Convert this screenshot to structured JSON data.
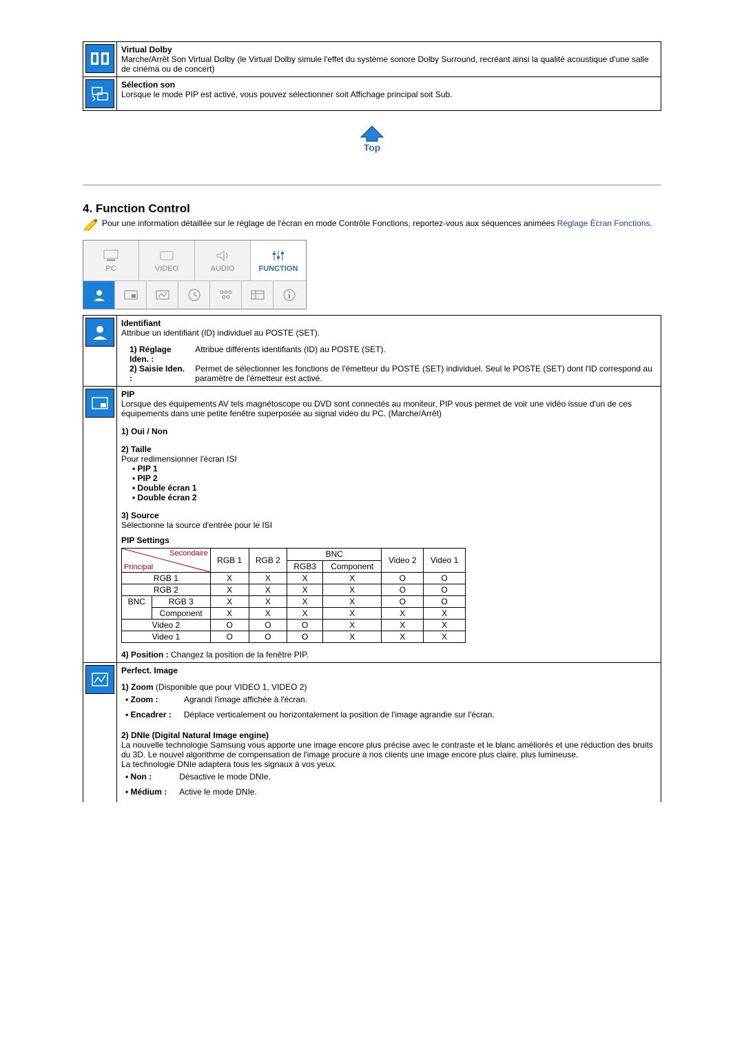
{
  "audio_section": {
    "virtual_dolby": {
      "title": "Virtual Dolby",
      "desc": "Marche/Arrêt Son Virtual Dolby (le Virtual Dolby simule l'effet du système sonore Dolby Surround, recréant ainsi la qualité acoustique d'une salle de cinéma ou de concert)"
    },
    "sound_select": {
      "title": "Sélection son",
      "desc": "Lorsque le mode PIP est activé, vous pouvez sélectionner soit Affichage principal soit Sub."
    }
  },
  "top_label": "Top",
  "section4": {
    "heading": "4. Function Control",
    "intro": "Pour une information détaillée sur le réglage de l'écran en mode Contrôle Fonctions, reportez-vous aux séquences animées ",
    "intro_link": "Réglage Écran Fonctions",
    "intro_end": ".",
    "tabs": {
      "pc": "PC",
      "video": "VIDEO",
      "audio": "AUDIO",
      "function": "FUNCTION"
    }
  },
  "identifiant": {
    "title": "Identifiant",
    "desc": "Attribue un identifiant (ID) individuel au POSTE (SET).",
    "row1_label": "1) Réglage Iden. :",
    "row1_desc": "Attribue différents identifiants (ID) au POSTE (SET).",
    "row2_label": "2) Saisie Iden. :",
    "row2_desc": "Permet de sélectionner les fonctions de l'émetteur du POSTE (SET) individuel. Seul le POSTE (SET) dont l'ID correspond au paramètre de l'émetteur est activé."
  },
  "pip": {
    "title": "PIP",
    "desc": "Lorsque des équipements AV tels magnétoscope ou DVD sont connectés au moniteur, PIP vous permet de voir une vidéo issue d'un de ces équipements dans une petite fenêtre superposée au signal vidéo du PC. (Marche/Arrêt)",
    "opt1": "1) Oui / Non",
    "opt2": "2) Taille",
    "opt2_desc": "Pour redimensionner l'écran ISI",
    "bullets": [
      "• PIP 1",
      "• PIP 2",
      "• Double écran 1",
      "• Double écran 2"
    ],
    "opt3": "3) Source",
    "opt3_desc": "Sélectionne la source d'entrée pour le ISI",
    "settings_title": "PIP Settings",
    "diag_secondary": "Secondaire",
    "diag_primary": "Principal",
    "headers": {
      "rgb1": "RGB 1",
      "rgb2": "RGB 2",
      "bnc": "BNC",
      "rgb3": "RGB3",
      "component": "Component",
      "video2": "Video 2",
      "video1": "Video 1"
    },
    "row_labels": {
      "rgb1": "RGB 1",
      "rgb2": "RGB 2",
      "bnc": "BNC",
      "rgb3": "RGB 3",
      "component": "Component",
      "video2": "Video 2",
      "video1": "Video 1"
    },
    "grid": [
      [
        "X",
        "X",
        "X",
        "X",
        "O",
        "O"
      ],
      [
        "X",
        "X",
        "X",
        "X",
        "O",
        "O"
      ],
      [
        "X",
        "X",
        "X",
        "X",
        "O",
        "O"
      ],
      [
        "X",
        "X",
        "X",
        "X",
        "X",
        "X"
      ],
      [
        "O",
        "O",
        "O",
        "X",
        "X",
        "X"
      ],
      [
        "O",
        "O",
        "O",
        "X",
        "X",
        "X"
      ]
    ],
    "opt4_label": "4) Position :",
    "opt4_desc": "Changez la position de la fenêtre PIP."
  },
  "perfect_image": {
    "title": "Perfect. Image",
    "zoom_label": "1) Zoom",
    "zoom_avail": " (Disponible que pour VIDEO 1, VIDEO 2)",
    "zoom_b_label": "• Zoom :",
    "zoom_b_desc": "Agrandi l'image affichée à l'écran.",
    "enc_label": "• Encadrer :",
    "enc_desc": "Déplace verticalement ou horizontalement la position de l'image agrandie sur l'écran.",
    "dnie_label": "2) DNIe (Digital Natural Image engine)",
    "dnie_desc": "La nouvelle technologie Samsung vous apporte une image encore plus précise avec le contraste et le blanc améliorés et une réduction des bruits du 3D. Le nouvel algorithme de compensation de l'image procure à nos clients une image encore plus claire, plus lumineuse.\nLa technologie DNIe adaptera tous les signaux à vos yeux.",
    "non_label": "• Non :",
    "non_desc": "Désactive le mode DNIe.",
    "med_label": "• Médium :",
    "med_desc": "Active le mode DNIe."
  }
}
